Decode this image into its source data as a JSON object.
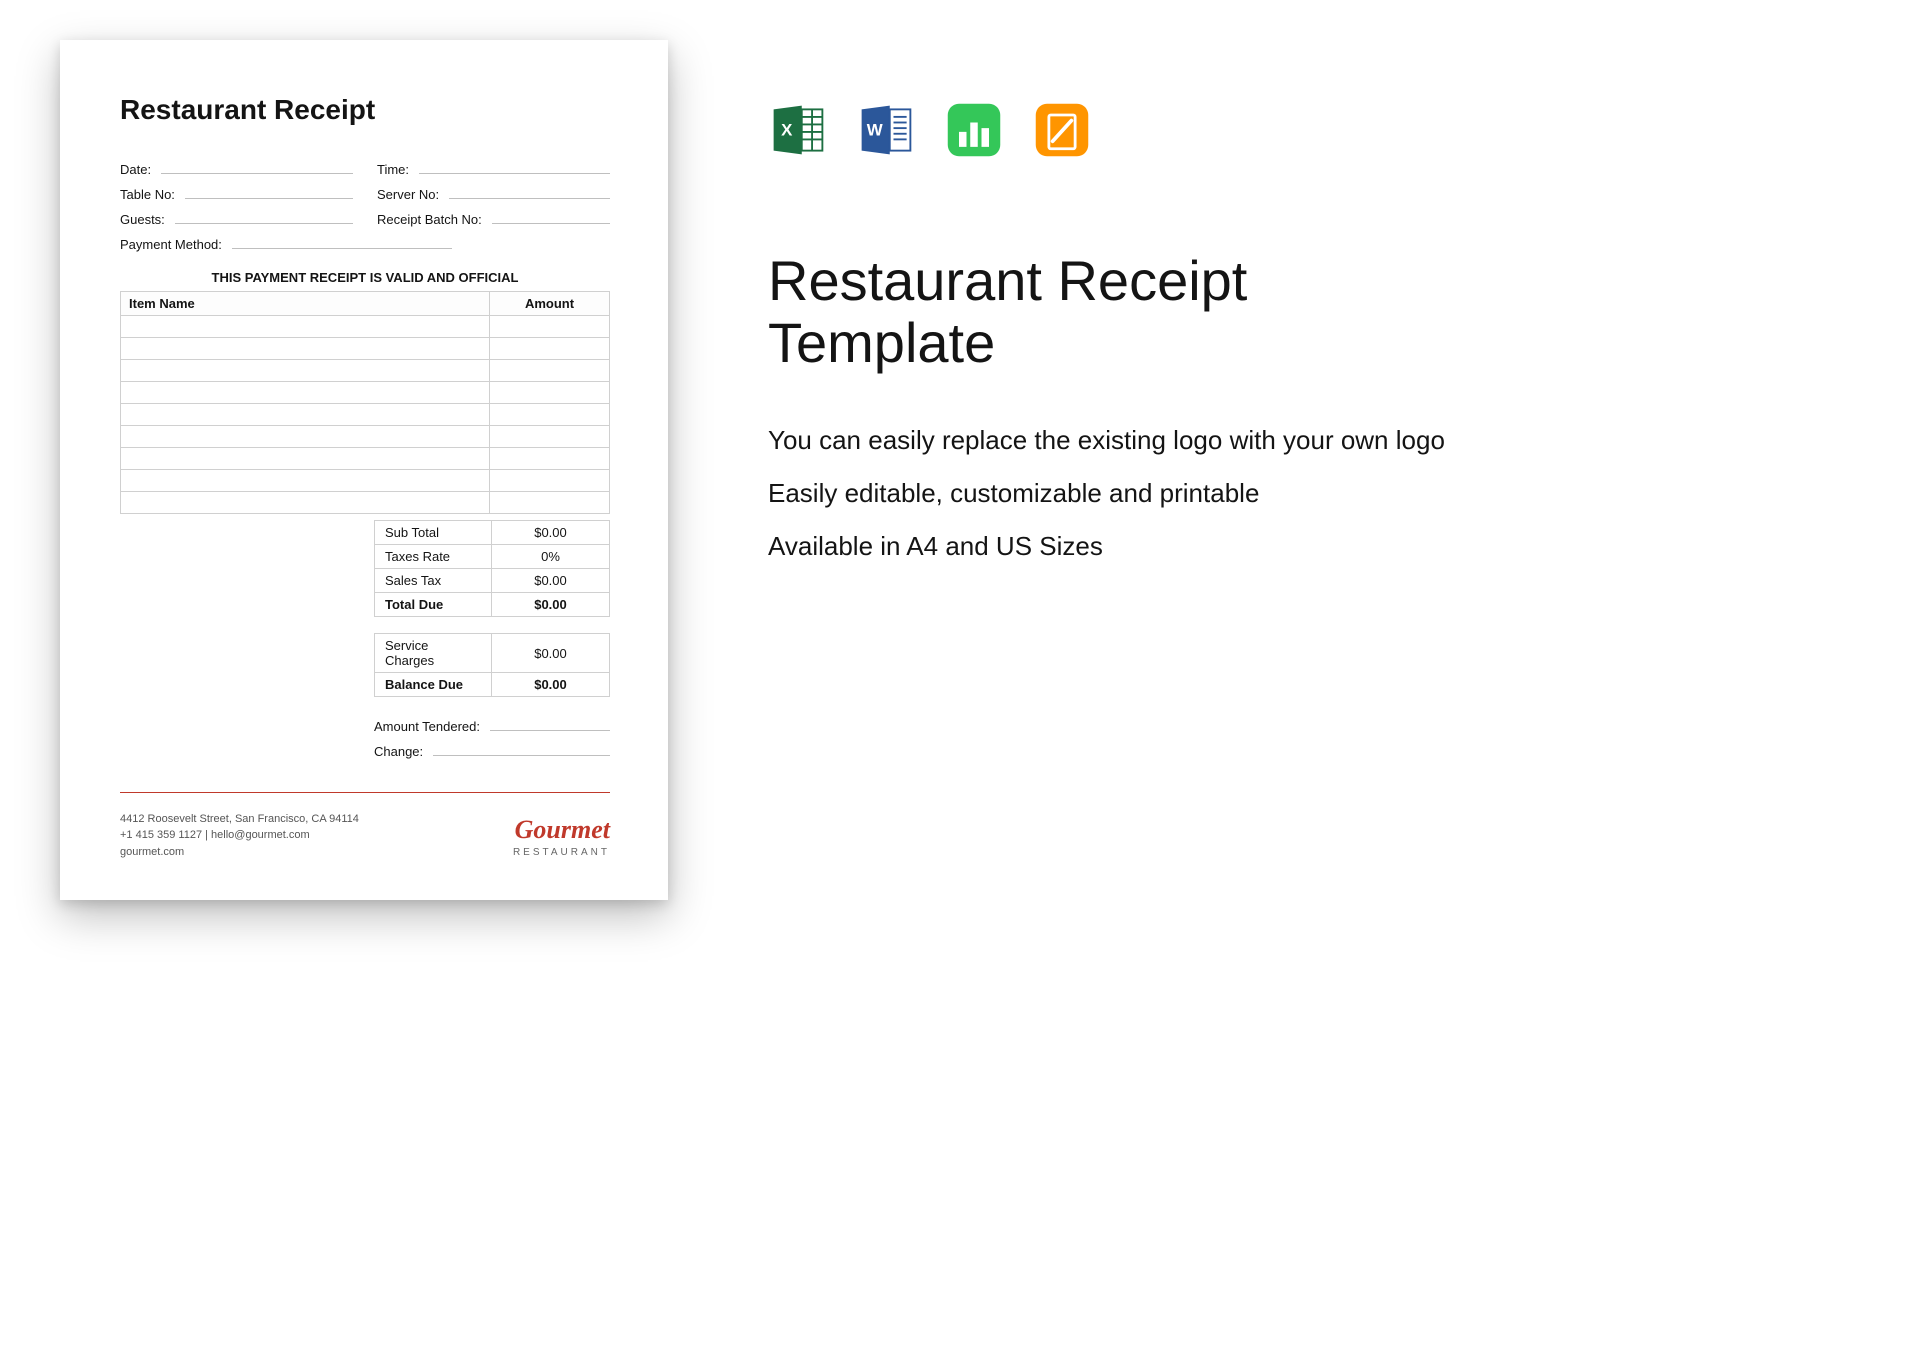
{
  "receipt": {
    "title": "Restaurant Receipt",
    "fields": {
      "date": "Date:",
      "time": "Time:",
      "table_no": "Table No:",
      "server_no": "Server No:",
      "guests": "Guests:",
      "receipt_batch_no": "Receipt Batch No:",
      "payment_method": "Payment Method:"
    },
    "validity_notice": "THIS PAYMENT RECEIPT IS VALID AND OFFICIAL",
    "table_headers": {
      "item_name": "Item Name",
      "amount": "Amount"
    },
    "totals": {
      "sub_total_label": "Sub Total",
      "sub_total_value": "$0.00",
      "taxes_rate_label": "Taxes Rate",
      "taxes_rate_value": "0%",
      "sales_tax_label": "Sales Tax",
      "sales_tax_value": "$0.00",
      "total_due_label": "Total Due",
      "total_due_value": "$0.00",
      "service_charges_label": "Service Charges",
      "service_charges_value": "$0.00",
      "balance_due_label": "Balance Due",
      "balance_due_value": "$0.00"
    },
    "tendered": {
      "amount_tendered_label": "Amount Tendered:",
      "change_label": "Change:"
    },
    "footer": {
      "address": "4412 Roosevelt Street, San Francisco, CA 94114",
      "contact": "+1 415 359 1127 | hello@gourmet.com",
      "website": "gourmet.com",
      "brand_name": "Gourmet",
      "brand_sub": "RESTAURANT"
    }
  },
  "info": {
    "title": "Restaurant Receipt Template",
    "bullets": [
      "You can easily replace the existing logo with your own logo",
      "Easily editable, customizable and printable",
      "Available in A4 and US Sizes"
    ],
    "formats": [
      "excel",
      "word",
      "numbers",
      "pages"
    ]
  }
}
